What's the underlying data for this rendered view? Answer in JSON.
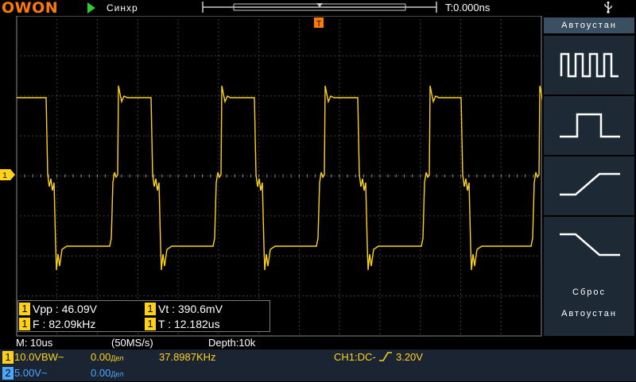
{
  "header": {
    "logo": "OWON",
    "trigger_state": "Синхр",
    "trigger_time": "T:0.000ns",
    "usb_icon": "usb-icon"
  },
  "measurements": {
    "vpp": "Vpp : 46.09V",
    "vt": "Vt : 390.6mV",
    "freq": "F : 82.09kHz",
    "period": "T : 12.182us",
    "channel": "1"
  },
  "menu": {
    "title": "Автоустан",
    "buttons": [
      "multi-period-icon",
      "single-period-icon",
      "rising-edge-icon",
      "falling-edge-icon"
    ],
    "reset_line1": "Сброс",
    "reset_line2": "Автоустан"
  },
  "status": {
    "timebase": "M: 10us",
    "sample_rate": "(50MS/s)",
    "depth": "Depth:10k"
  },
  "channels": {
    "ch1": {
      "label": "1",
      "scale": "10.0V",
      "bw": "BW~",
      "offset": "0.00",
      "offset_unit": "Дел",
      "freq_counter": "37.8987KHz",
      "trigger": "CH1:DC-",
      "trigger_level": "3.20V",
      "color": "#ffd21a"
    },
    "ch2": {
      "label": "2",
      "scale": "5.00V",
      "coupling": "~",
      "offset": "0.00",
      "offset_unit": "Дел",
      "color": "#4aa8ff"
    }
  },
  "colors": {
    "accent": "#ff7a00",
    "ch1": "#ffd21a",
    "ch2": "#4aa8ff",
    "menu_bg": "#1d2a36"
  }
}
